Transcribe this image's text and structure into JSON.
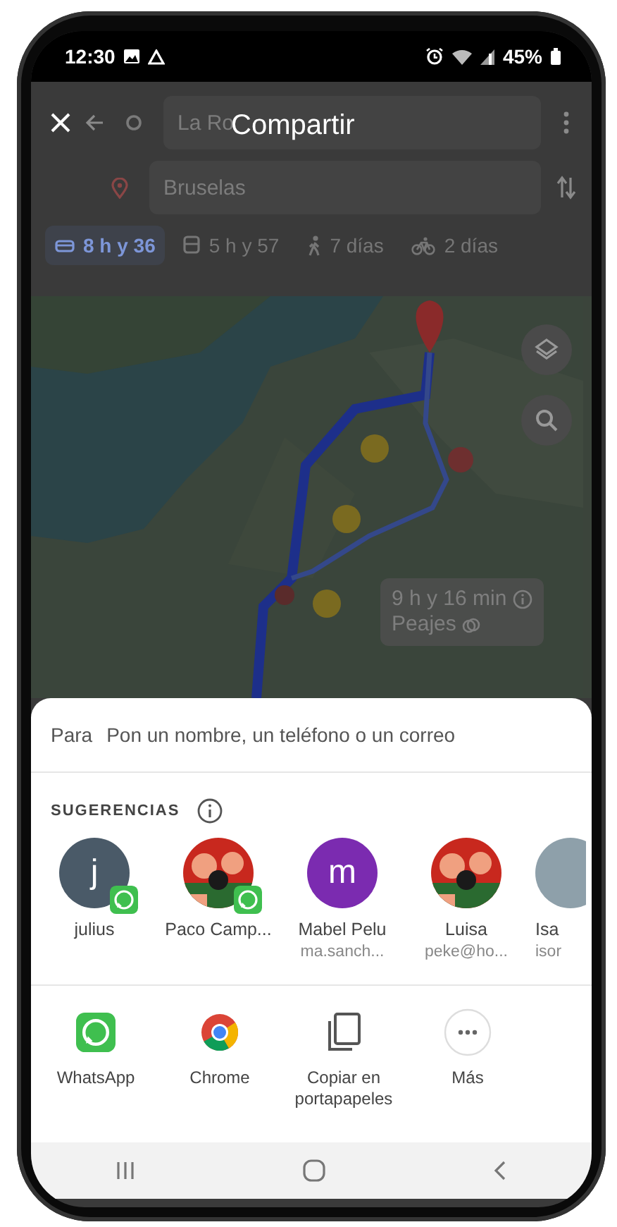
{
  "status_bar": {
    "time": "12:30",
    "battery": "45%"
  },
  "header": {
    "title": "Compartir",
    "origin": "La Ro",
    "destination": "Bruselas",
    "modes": [
      {
        "kind": "car",
        "label": "8 h y 36",
        "selected": true
      },
      {
        "kind": "transit",
        "label": "5 h y 57",
        "selected": false
      },
      {
        "kind": "walk",
        "label": "7 días",
        "selected": false
      },
      {
        "kind": "bike",
        "label": "2 días",
        "selected": false
      }
    ]
  },
  "map": {
    "route_card": {
      "duration": "9 h y 16 min",
      "note": "Peajes"
    }
  },
  "share_sheet": {
    "to_label": "Para",
    "to_placeholder": "Pon un nombre, un teléfono o un correo",
    "suggestions_title": "SUGERENCIAS",
    "contacts": [
      {
        "kind": "letter",
        "initial": "j",
        "color": "#4a5a68",
        "name": "julius",
        "whatsapp": true
      },
      {
        "name": "Paco Camp...",
        "whatsapp": true
      },
      {
        "kind": "letter",
        "initial": "m",
        "color": "#7b2bb0",
        "name": "Mabel Pelu",
        "detail": "ma.sanch...",
        "whatsapp": false
      },
      {
        "name": "Luisa",
        "detail": "peke@ho...",
        "whatsapp": false
      },
      {
        "kind": "blank",
        "color": "#8ea0aa",
        "name": "Isa",
        "detail": "isor",
        "whatsapp": false
      }
    ],
    "apps": [
      {
        "kind": "whatsapp",
        "label": "WhatsApp"
      },
      {
        "kind": "chrome",
        "label": "Chrome"
      },
      {
        "kind": "copy",
        "label": "Copiar en portapapeles"
      },
      {
        "kind": "more",
        "label": "Más"
      }
    ]
  }
}
